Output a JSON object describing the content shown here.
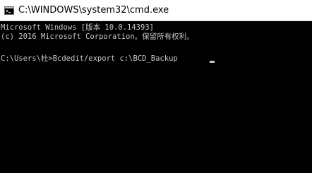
{
  "window": {
    "title": "C:\\WINDOWS\\system32\\cmd.exe",
    "icon": "cmd-icon"
  },
  "console": {
    "lines": [
      "Microsoft Windows [版本 10.0.14393]",
      "(c) 2016 Microsoft Corporation。保留所有权利。",
      "C:\\Users\\杜>Bcdedit/export c:\\BCD_Backup"
    ]
  },
  "colors": {
    "background": "#000000",
    "text": "#c8c8c8",
    "titlebar": "#ffffff"
  }
}
